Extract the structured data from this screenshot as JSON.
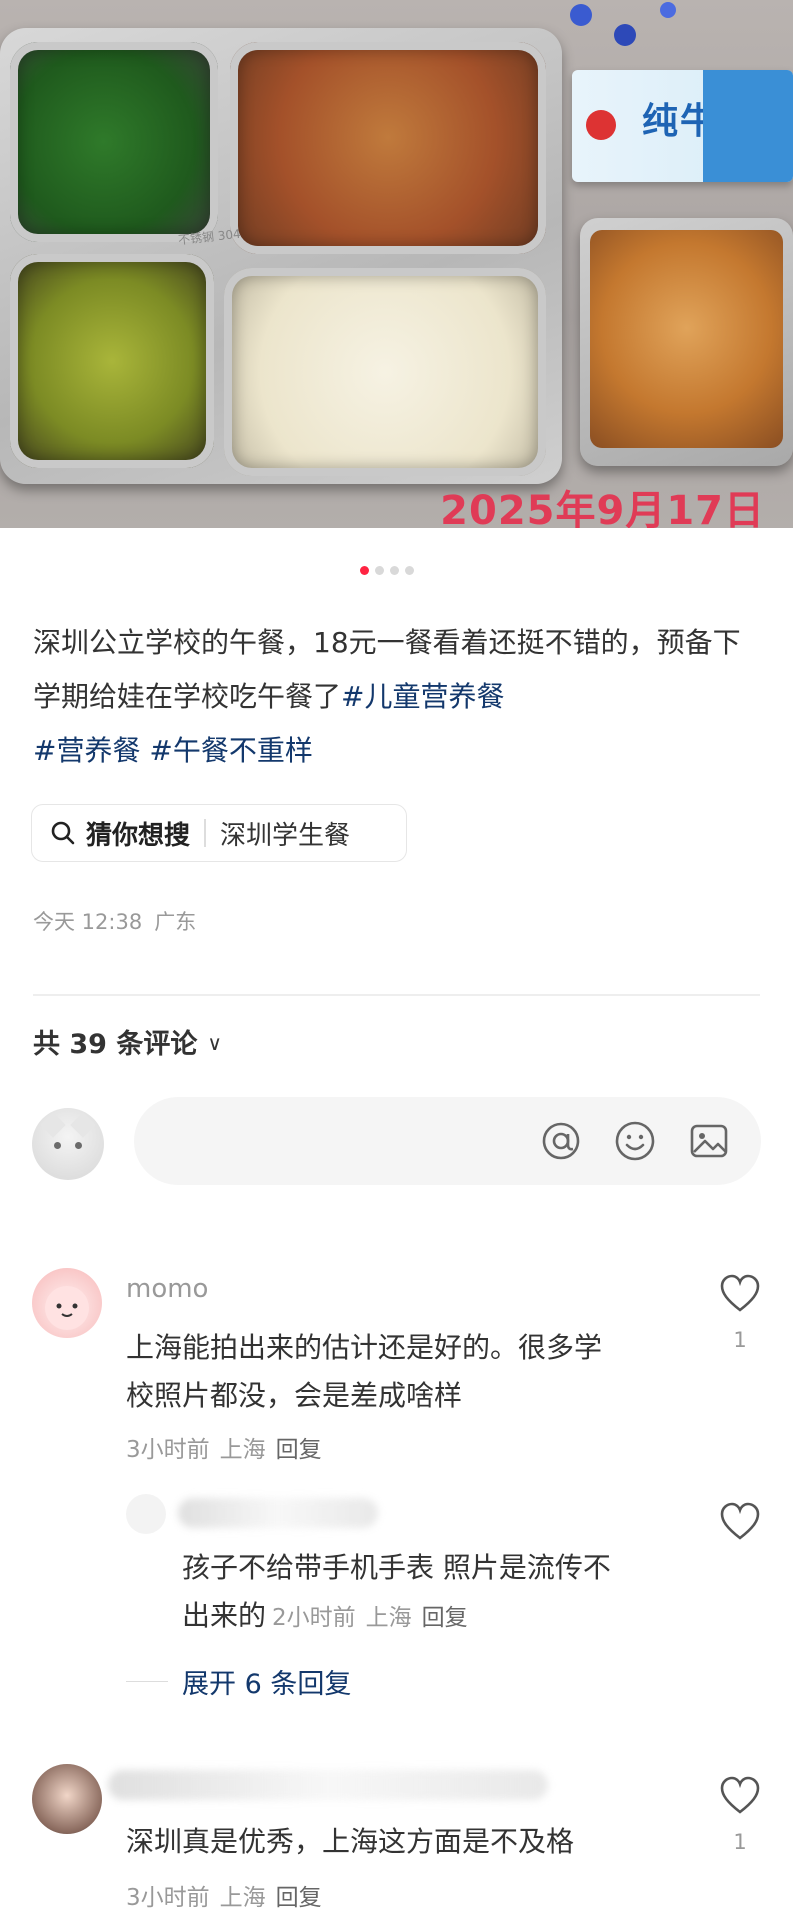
{
  "photo": {
    "date_stamp": "2025年9月17日",
    "milk_label": "纯牛奶",
    "tray_engraving": "不锈钢 304",
    "carousel": {
      "total": 4,
      "active": 1
    }
  },
  "post": {
    "text": "深圳公立学校的午餐，18元一餐看着还挺不错的，预备下学期给娃在学校吃午餐了",
    "tags": [
      "#儿童营养餐",
      "#营养餐",
      "#午餐不重样"
    ],
    "search_suggest": {
      "label": "猜你想搜",
      "value": "深圳学生餐"
    },
    "time": "今天 12:38",
    "location": "广东"
  },
  "comments_header": {
    "count_label": "共 39 条评论"
  },
  "comment_input": {
    "placeholder": "",
    "icons": [
      "at-icon",
      "emoji-icon",
      "image-icon"
    ]
  },
  "comments": [
    {
      "name": "momo",
      "text_line1": "上海能拍出来的估计还是好的。很多学",
      "text_line2": "校照片都没，会是差成啥样",
      "time": "3小时前",
      "location": "上海",
      "reply_label": "回复",
      "likes": "1"
    },
    {
      "name": "",
      "text_line1": "孩子不给带手机手表 照片是流传不",
      "text_line2": "出来的",
      "time": "2小时前",
      "location": "上海",
      "reply_label": "回复",
      "likes": ""
    },
    {
      "name": "",
      "text_line1": "深圳真是优秀，上海这方面是不及格",
      "time": "3小时前",
      "location": "上海",
      "reply_label": "回复",
      "likes": "1"
    }
  ],
  "expand_replies": {
    "label": "展开 6 条回复"
  },
  "colors": {
    "accent": "#ff2442",
    "tag": "#13386c",
    "date_stamp": "#e03b56"
  }
}
